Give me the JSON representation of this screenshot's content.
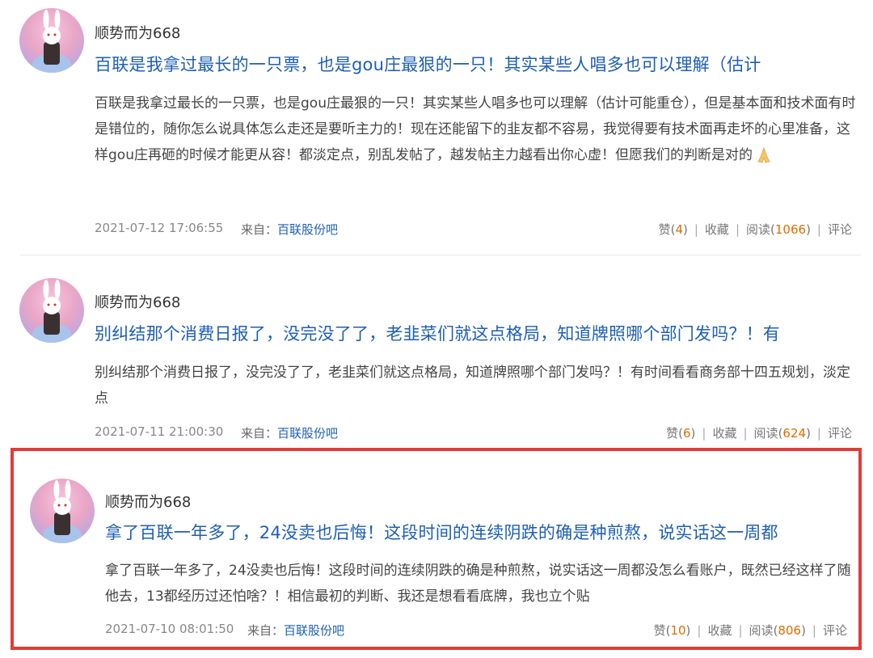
{
  "posts": [
    {
      "username": "顺势而为668",
      "title": "百联是我拿过最长的一只票，也是gou庄最狠的一只！其实某些人唱多也可以理解（估计",
      "body": "百联是我拿过最长的一只票，也是gou庄最狠的一只！其实某些人唱多也可以理解（估计可能重仓），但是基本面和技术面有时是错位的，随你怎么说具体怎么走还是要听主力的！现在还能留下的韭友都不容易，我觉得要有技术面再走坏的心里准备，这样gou庄再砸的时候才能更从容！都淡定点，别乱发帖了，越发帖主力越看出你心虚！但愿我们的判断是对的",
      "emoji": "praying-hands-emoji",
      "time": "2021-07-12 17:06:55",
      "from_label": "来自：",
      "from_bar": "百联股份吧",
      "like_label": "赞",
      "like_count": "4",
      "collect_label": "收藏",
      "read_label": "阅读",
      "read_count": "1066",
      "comment_label": "评论"
    },
    {
      "username": "顺势而为668",
      "title": "别纠结那个消费日报了，没完没了了，老韭菜们就这点格局，知道牌照哪个部门发吗？！有",
      "body": "别纠结那个消费日报了，没完没了了，老韭菜们就这点格局，知道牌照哪个部门发吗？！有时间看看商务部十四五规划，淡定点",
      "time": "2021-07-11 21:00:30",
      "from_label": "来自：",
      "from_bar": "百联股份吧",
      "like_label": "赞",
      "like_count": "6",
      "collect_label": "收藏",
      "read_label": "阅读",
      "read_count": "624",
      "comment_label": "评论"
    },
    {
      "username": "顺势而为668",
      "title": "拿了百联一年多了，24没卖也后悔！这段时间的连续阴跌的确是种煎熬，说实话这一周都",
      "body": "拿了百联一年多了，24没卖也后悔！这段时间的连续阴跌的确是种煎熬，说实话这一周都没怎么看账户，既然已经这样了随他去，13都经历过还怕啥？！相信最初的判断、我还是想看看底牌，我也立个贴",
      "time": "2021-07-10 08:01:50",
      "from_label": "来自：",
      "from_bar": "百联股份吧",
      "like_label": "赞",
      "like_count": "10",
      "collect_label": "收藏",
      "read_label": "阅读",
      "read_count": "806",
      "comment_label": "评论"
    }
  ],
  "colors": {
    "link": "#1e5fb3",
    "count": "#e06c00",
    "highlight": "#e53a3a"
  }
}
